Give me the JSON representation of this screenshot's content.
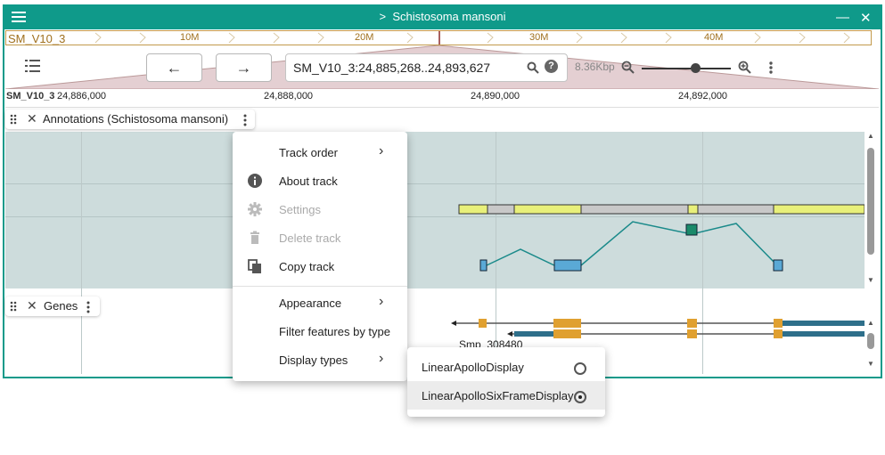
{
  "window": {
    "title": "Schistosoma mansoni"
  },
  "overview": {
    "refname": "SM_V10_3",
    "ticks": [
      "10M",
      "20M",
      "30M",
      "40M"
    ]
  },
  "toolbar": {
    "location": "SM_V10_3:24,885,268..24,893,627",
    "zoom_label": "8.36Kbp",
    "back_label": "←",
    "forward_label": "→"
  },
  "ruler": {
    "refname": "SM_V10_3",
    "ticks": [
      "24,886,000",
      "24,888,000",
      "24,890,000",
      "24,892,000"
    ]
  },
  "tracks": {
    "annotations": {
      "label": "Annotations (Schistosoma mansoni)"
    },
    "genes": {
      "label": "Genes",
      "feature_label": "Smp_308480"
    }
  },
  "track_menu": {
    "items": [
      {
        "label": "Track order",
        "icon": "none",
        "submenu": true,
        "disabled": false
      },
      {
        "label": "About track",
        "icon": "info-icon",
        "submenu": false,
        "disabled": false
      },
      {
        "label": "Settings",
        "icon": "gear-icon",
        "submenu": false,
        "disabled": true
      },
      {
        "label": "Delete track",
        "icon": "trash-icon",
        "submenu": false,
        "disabled": true
      },
      {
        "label": "Copy track",
        "icon": "copy-icon",
        "submenu": false,
        "disabled": false
      },
      {
        "label": "Appearance",
        "icon": "none",
        "submenu": true,
        "disabled": false
      },
      {
        "label": "Filter features by type",
        "icon": "none",
        "submenu": false,
        "disabled": false
      },
      {
        "label": "Display types",
        "icon": "none",
        "submenu": true,
        "disabled": false
      }
    ]
  },
  "display_types_menu": {
    "items": [
      {
        "label": "LinearApolloDisplay",
        "selected": false
      },
      {
        "label": "LinearApolloSixFrameDisplay",
        "selected": true
      }
    ]
  },
  "colors": {
    "accent": "#0f9a8a",
    "cds": "#e8f07a",
    "exon": "#e0a030",
    "utr": "#2e6f8a"
  }
}
